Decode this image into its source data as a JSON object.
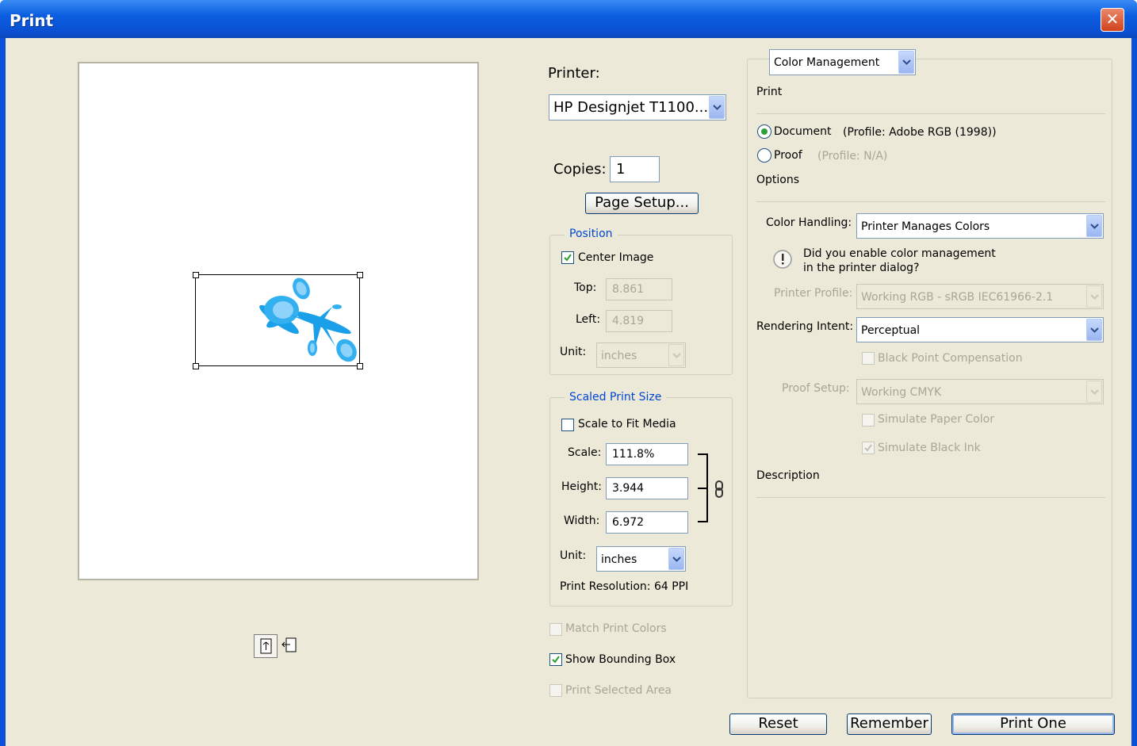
{
  "window": {
    "title": "Print"
  },
  "printer": {
    "label": "Printer:",
    "value": "HP Designjet T1100..."
  },
  "copies": {
    "label": "Copies:",
    "value": "1"
  },
  "page_setup": {
    "label": "Page Setup..."
  },
  "position": {
    "legend": "Position",
    "center_image_label": "Center Image",
    "center_image_checked": true,
    "top_label": "Top:",
    "top_value": "8.861",
    "left_label": "Left:",
    "left_value": "4.819",
    "unit_label": "Unit:",
    "unit_value": "inches"
  },
  "scaled": {
    "legend": "Scaled Print Size",
    "scale_to_fit_label": "Scale to Fit Media",
    "scale_to_fit_checked": false,
    "scale_label": "Scale:",
    "scale_value": "111.8%",
    "height_label": "Height:",
    "height_value": "3.944",
    "width_label": "Width:",
    "width_value": "6.972",
    "unit_label": "Unit:",
    "unit_value": "inches",
    "resolution": "Print Resolution: 64 PPI"
  },
  "bottom_checks": {
    "match_colors": "Match Print Colors",
    "bounding_box": "Show Bounding Box",
    "bounding_box_checked": true,
    "selected_area": "Print Selected Area"
  },
  "color_mgmt": {
    "mode": "Color Management",
    "print_header": "Print",
    "document_label": "Document",
    "document_profile": "(Profile: Adobe RGB (1998))",
    "proof_label": "Proof",
    "proof_profile": "(Profile: N/A)",
    "options_header": "Options",
    "color_handling_label": "Color Handling:",
    "color_handling_value": "Printer Manages Colors",
    "warning_line1": "Did you enable color management",
    "warning_line2": "in the printer dialog?",
    "printer_profile_label": "Printer Profile:",
    "printer_profile_value": "Working RGB - sRGB IEC61966-2.1",
    "rendering_intent_label": "Rendering Intent:",
    "rendering_intent_value": "Perceptual",
    "black_point": "Black Point Compensation",
    "proof_setup_label": "Proof Setup:",
    "proof_setup_value": "Working CMYK",
    "simulate_paper": "Simulate Paper Color",
    "simulate_ink": "Simulate Black Ink",
    "description_header": "Description"
  },
  "buttons": {
    "reset": "Reset",
    "remember": "Remember",
    "print_one": "Print One"
  },
  "colors": {
    "title_bar": "#0a50d8",
    "dialog_bg": "#ece9d8",
    "accent": "#0046d5",
    "preview_art": "#1aa0e8"
  }
}
